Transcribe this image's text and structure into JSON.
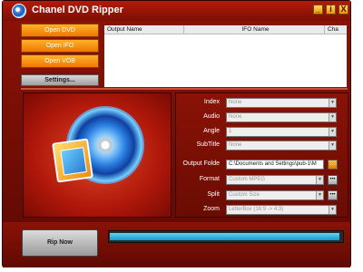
{
  "window": {
    "title": "Chanel DVD Ripper"
  },
  "titlebar_buttons": [
    "_",
    "i",
    "X"
  ],
  "side_buttons": [
    "Open DVD",
    "Open IFO",
    "Open VOB"
  ],
  "settings_label": "Settings...",
  "list": {
    "columns": [
      "Output Name",
      "IFO Name",
      "Cha"
    ],
    "rows": []
  },
  "props": {
    "index": {
      "label": "Index",
      "value": "None"
    },
    "audio": {
      "label": "Audio",
      "value": "None"
    },
    "angle": {
      "label": "Angle",
      "value": "1"
    },
    "subtitle": {
      "label": "SubTitle",
      "value": "None"
    },
    "output_folder": {
      "label": "Output Folde",
      "value": "C:\\Documents and Settings\\pub-1\\M"
    },
    "format": {
      "label": "Format",
      "value": "Custom MPEG"
    },
    "split": {
      "label": "Split",
      "value": "Custom Size"
    },
    "zoom": {
      "label": "Zoom",
      "value": "LetterBox (16:9 -> 4:3)"
    }
  },
  "rip_label": "Rip Now",
  "progress": {
    "fraction": 0.99
  },
  "icons": {
    "app": "dvd-disc-icon",
    "browse": "folder-icon",
    "format_settings": "ellipsis-icon",
    "split_settings": "ellipsis-icon"
  }
}
